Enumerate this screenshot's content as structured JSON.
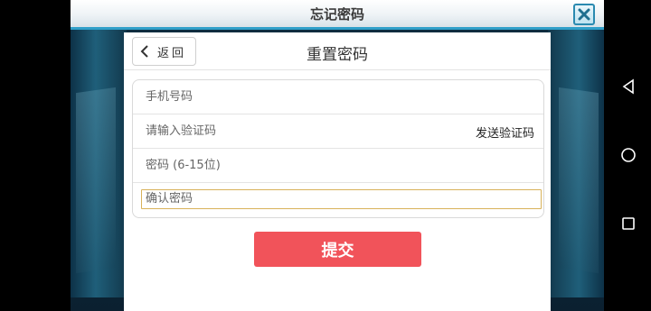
{
  "window": {
    "title": "忘记密码"
  },
  "dialog": {
    "back_label": "返回",
    "heading": "重置密码"
  },
  "form": {
    "phone_placeholder": "手机号码",
    "code_placeholder": "请输入验证码",
    "send_code_label": "发送验证码",
    "password_placeholder": "密码 (6-15位)",
    "confirm_placeholder": "确认密码"
  },
  "submit_label": "提交",
  "icons": {
    "close": "close-icon",
    "back": "chevron-left-icon",
    "nav_back": "triangle-back-icon",
    "nav_home": "circle-home-icon",
    "nav_recent": "square-recent-icon"
  },
  "colors": {
    "accent": "#2f9fc9",
    "submit": "#f1535a",
    "focus_border": "#d8b25a"
  }
}
